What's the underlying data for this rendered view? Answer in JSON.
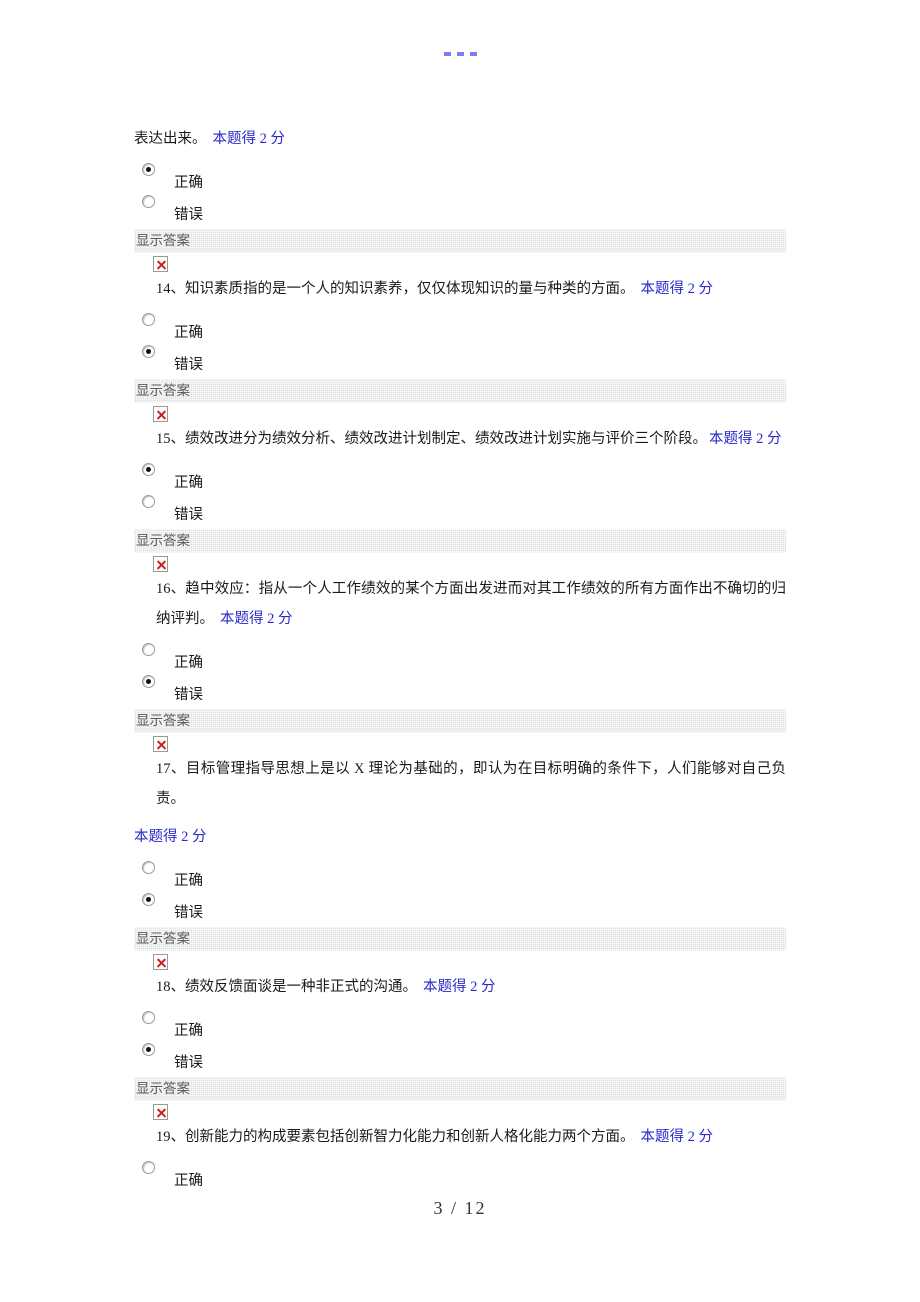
{
  "document": {
    "top_marks": [
      "-",
      "-",
      "-"
    ],
    "page_indicator": "3  /  12",
    "answer_bar_label": "显示答案",
    "option_true": "正确",
    "option_false": "错误",
    "score_blue_hex": "#2a2ac8",
    "bar_gray_hex": "#e0e0e0",
    "broken_icon_name": "broken-image"
  },
  "intro": {
    "continuation_text": "表达出来。",
    "score": "本题得  2  分",
    "selected": "true"
  },
  "questions": [
    {
      "number": "14",
      "text": "14、知识素质指的是一个人的知识素养，仅仅体现知识的量与种类的方面。",
      "score": "本题得  2  分",
      "score_inline": true,
      "selected": "false",
      "wrap": false
    },
    {
      "number": "15",
      "text": "15、绩效改进分为绩效分析、绩效改进计划制定、绩效改进计划实施与评价三个阶段。",
      "score": "本题得 2 分",
      "score_inline": true,
      "selected": "true",
      "wrap": false
    },
    {
      "number": "16",
      "text": "16、趋中效应：指从一个人工作绩效的某个方面出发进而对其工作绩效的所有方面作出不确切的归纳评判。",
      "score": "本题得  2  分",
      "score_inline": true,
      "selected": "false",
      "wrap": true
    },
    {
      "number": "17",
      "text": "17、目标管理指导思想上是以 X 理论为基础的，即认为在目标明确的条件下，人们能够对自己负责。",
      "score": "本题得 2 分",
      "score_inline": false,
      "selected": "false",
      "wrap": true
    },
    {
      "number": "18",
      "text": "18、绩效反馈面谈是一种非正式的沟通。",
      "score": "本题得  2  分",
      "score_inline": true,
      "selected": "false",
      "wrap": false
    },
    {
      "number": "19",
      "text": "19、创新能力的构成要素包括创新智力化能力和创新人格化能力两个方面。",
      "score": "本题得  2  分",
      "score_inline": true,
      "selected": "none",
      "wrap": false
    }
  ]
}
